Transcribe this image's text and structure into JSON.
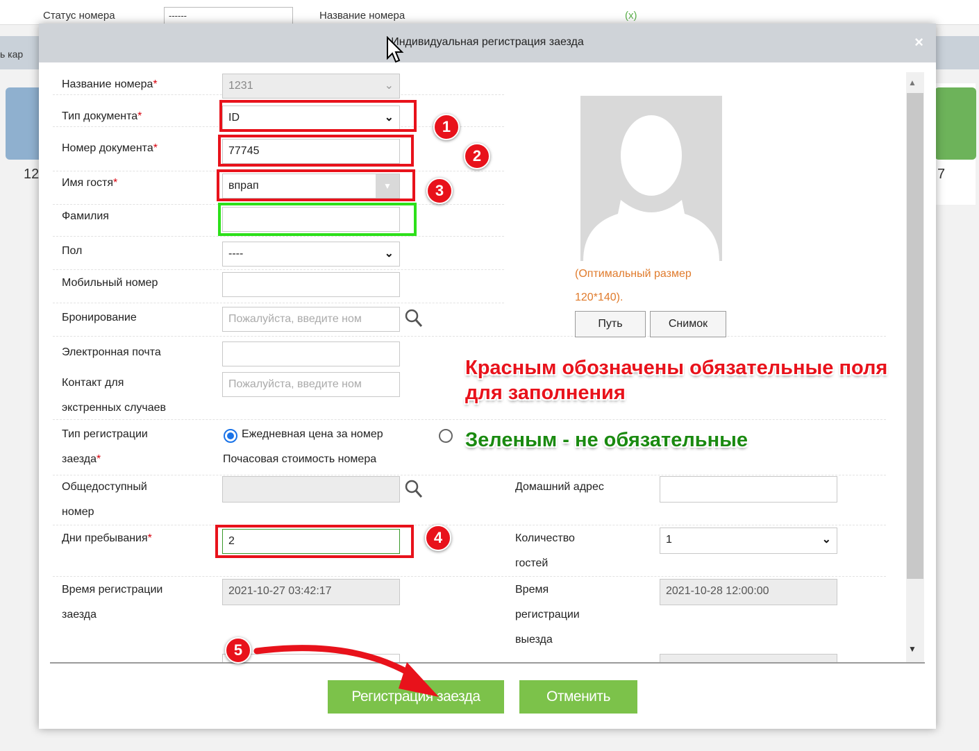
{
  "background": {
    "filter_labels": [
      "Статус номера",
      "Название номера"
    ],
    "status_select_value": "------",
    "left_bar_text": "ь кар",
    "card_numbers": [
      "12",
      "7"
    ],
    "top_icon": "(x)"
  },
  "dialog": {
    "title": "Индивидуальная регистрация заезда",
    "close_label": "×"
  },
  "form": {
    "room_name": {
      "label": "Название номера",
      "required": "*",
      "value": "1231"
    },
    "doc_type": {
      "label": "Тип документа",
      "required": "*",
      "value": "ID"
    },
    "doc_number": {
      "label": "Номер документа",
      "required": "*",
      "value": "77745"
    },
    "guest_name": {
      "label": "Имя гостя",
      "required": "*",
      "value": "впрап"
    },
    "surname": {
      "label": "Фамилия",
      "value": ""
    },
    "gender": {
      "label": "Пол",
      "value": "----"
    },
    "mobile": {
      "label": "Мобильный номер",
      "value": ""
    },
    "booking": {
      "label": "Бронирование",
      "placeholder": "Пожалуйста, введите ном"
    },
    "email": {
      "label": "Электронная почта",
      "value": ""
    },
    "emergency": {
      "label_line1": "Контакт для",
      "label_line2": "экстренных случаев",
      "placeholder": "Пожалуйста, введите ном"
    },
    "checkin_type": {
      "label_line1": "Тип регистрации",
      "label_line2": "заезда",
      "required": "*",
      "option_daily": "Ежедневная цена за номер",
      "option_hourly": "Почасовая стоимость номера",
      "selected": "daily"
    },
    "public_room": {
      "label_line1": "Общедоступный",
      "label_line2": "номер",
      "value": ""
    },
    "home_address": {
      "label": "Домашний адрес",
      "value": ""
    },
    "stay_days": {
      "label": "Дни пребывания",
      "required": "*",
      "value": "2"
    },
    "guest_count": {
      "label_line1": "Количество",
      "label_line2": "гостей",
      "value": "1"
    },
    "checkin_time": {
      "label_line1": "Время регистрации",
      "label_line2": "заезда",
      "value": "2021-10-27 03:42:17"
    },
    "checkout_time": {
      "label_line1": "Время",
      "label_line2": "регистрации",
      "label_line3": "выезда",
      "value": "2021-10-28 12:00:00"
    }
  },
  "photo": {
    "hint_line1": "(Оптимальный размер",
    "hint_line2": "120*140).",
    "path_button": "Путь",
    "snapshot_button": "Снимок"
  },
  "annotations": {
    "red_note_line1": "Красным обозначены обязательные поля",
    "red_note_line2": "для заполнения",
    "green_note": "Зеленым - не обязательные",
    "badges": [
      "1",
      "2",
      "3",
      "4",
      "5"
    ]
  },
  "footer": {
    "submit_button": "Регистрация заезда",
    "cancel_button": "Отменить"
  },
  "colors": {
    "accent_green": "#7cc24a",
    "required_red": "#d8000c",
    "annotation_red": "#e8121b",
    "annotation_green": "#2de01a",
    "hint_orange": "#e07b2c"
  }
}
